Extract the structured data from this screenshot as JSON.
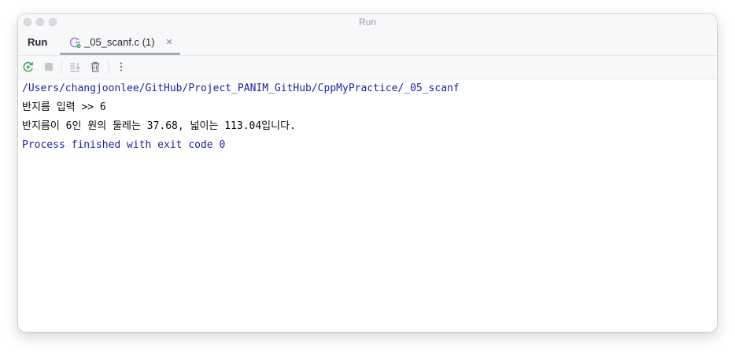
{
  "window": {
    "title": "Run"
  },
  "tool_window": {
    "title": "Run",
    "tab": {
      "label": "_05_scanf.c (1)",
      "icon": "c-file-icon",
      "close_icon": "close-icon"
    }
  },
  "toolbar": {
    "rerun_icon": "rerun-icon",
    "stop_icon": "stop-icon",
    "scroll_to_end_icon": "scroll-to-end-icon",
    "clear_icon": "trash-icon",
    "more_icon": "more-vertical-icon"
  },
  "console": {
    "lines": [
      "/Users/changjoonlee/GitHub/Project_PANIM_GitHub/CppMyPractice/_05_scanf",
      "반지름 입력 >> 6",
      "반지름이 6인 원의 둘레는 37.68, 넓이는 113.04입니다.",
      "Process finished with exit code 0"
    ]
  },
  "colors": {
    "console_system": "#1a1fa8",
    "console_output": "#080808",
    "tab_underline": "#a4a8b0",
    "rerun_green": "#4da363",
    "c_icon_purple": "#9b77d6"
  }
}
